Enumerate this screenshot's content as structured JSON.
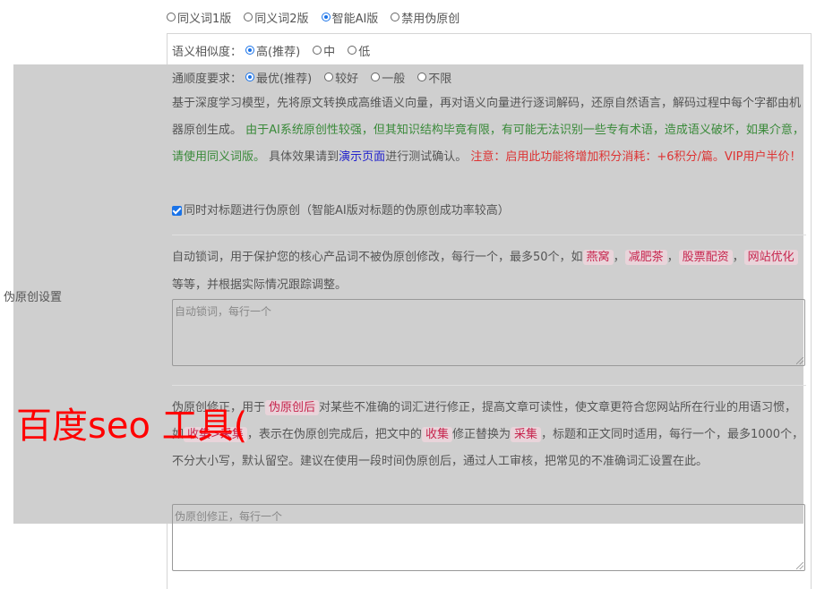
{
  "mode": {
    "options": [
      "同义词1版",
      "同义词2版",
      "智能AI版",
      "禁用伪原创"
    ],
    "selected": 2
  },
  "similarity": {
    "label": "语义相似度：",
    "options": [
      "高(推荐)",
      "中",
      "低"
    ],
    "selected": 0
  },
  "fluency": {
    "label": "通顺度要求：",
    "options": [
      "最优(推荐)",
      "较好",
      "一般",
      "不限"
    ],
    "selected": 0
  },
  "section_label": "伪原创设置",
  "ai_desc": {
    "p1": "基于深度学习模型，先将原文转换成高维语义向量，再对语义向量进行逐词解码，还原自然语言，解码过程中每个字都由机器原创生成。",
    "p2_green": "由于AI系统原创性较强，但其知识结构毕竟有限，有可能无法识别一些专有术语，造成语义破坏，如果介意，请使用同义词版。",
    "p3_pre": "具体效果请到",
    "p3_link": "演示页面",
    "p3_post": "进行测试确认。",
    "p4_red": "注意：启用此功能将增加积分消耗：+6积分/篇。VIP用户半价！"
  },
  "title_checkbox": {
    "checked": true,
    "label": "同时对标题进行伪原创（智能AI版对标题的伪原创成功率较高）"
  },
  "lock_words": {
    "desc_pre": "自动锁词，用于保护您的核心产品词不被伪原创修改，每行一个，最多50个，如",
    "examples": [
      "燕窝",
      "减肥茶",
      "股票配资",
      "网站优化"
    ],
    "sep": "，",
    "desc_post": "等等，并根据实际情况跟踪调整。",
    "placeholder": "自动锁词，每行一个"
  },
  "correction": {
    "desc_pre": "伪原创修正，用于",
    "tag1": "伪原创后",
    "desc_mid1": "对某些不准确的词汇进行修正，提高文章可读性，使文章更符合您网站所在行业的用语习惯，如",
    "tag2": "收集>采集",
    "desc_mid2": "，表示在伪原创完成后，把文中的",
    "tag3": "收集",
    "desc_mid3": "修正替换为",
    "tag4": "采集",
    "desc_post": "，标题和正文同时适用，每行一个，最多1000个，不分大小写，默认留空。建议在使用一段时间伪原创后，通过人工审核，把常见的不准确词汇设置在此。",
    "placeholder": "伪原创修正，每行一个"
  },
  "watermark": "百度seo 工具("
}
